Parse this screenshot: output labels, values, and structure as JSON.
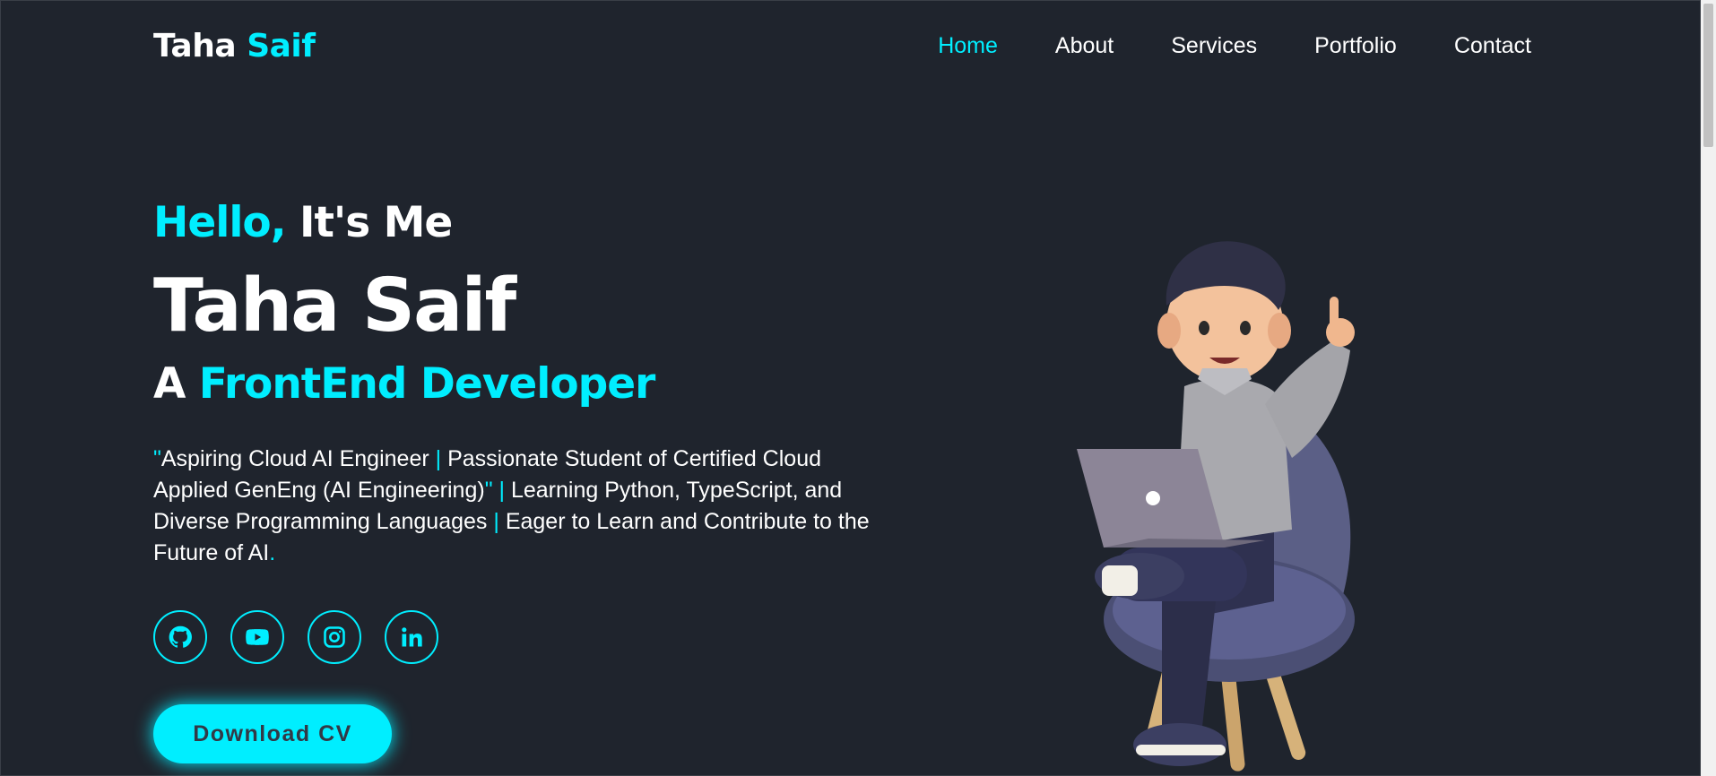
{
  "header": {
    "logo_first": "Taha",
    "logo_second": "Saif",
    "nav": [
      {
        "label": "Home",
        "active": true
      },
      {
        "label": "About"
      },
      {
        "label": "Services"
      },
      {
        "label": "Portfolio"
      },
      {
        "label": "Contact"
      }
    ]
  },
  "hero": {
    "greeting_accent": "Hello,",
    "greeting_rest": "It's Me",
    "name": "Taha Saif",
    "role_prefix": "A",
    "role_accent": "FrontEnd Developer",
    "bio_open_quote": "\"",
    "bio_part1": "Aspiring Cloud AI Engineer",
    "bio_sep": "|",
    "bio_part2": "Passionate Student of Certified Cloud Applied GenEng (AI Engineering)",
    "bio_close_quote": "\"",
    "bio_part3": "Learning Python, TypeScript, and Diverse Programming Languages",
    "bio_part4": "Eager to Learn and Contribute to the Future of AI",
    "bio_period": ".",
    "socials": [
      "github-icon",
      "youtube-icon",
      "instagram-icon",
      "linkedin-icon"
    ],
    "cv_button": "Download CV"
  },
  "colors": {
    "background": "#1f242d",
    "accent": "#00eeff",
    "text": "#ffffff"
  }
}
